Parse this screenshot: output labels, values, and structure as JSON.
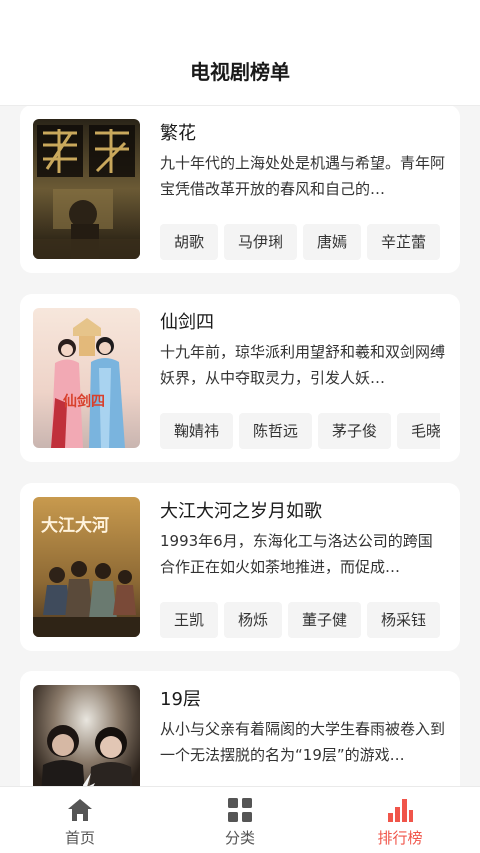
{
  "header": {
    "title": "电视剧榜单"
  },
  "dramas": [
    {
      "title": "繁花",
      "description": "九十年代的上海处处是机遇与希望。青年阿宝凭借改革开放的春风和自己的…",
      "cast": [
        "胡歌",
        "马伊琍",
        "唐嫣",
        "辛芷蕾"
      ],
      "poster_icon": "poster-fanhua"
    },
    {
      "title": "仙剑四",
      "description": "十九年前，琼华派利用望舒和羲和双剑网缚妖界，从中夺取灵力，引发人妖…",
      "cast": [
        "鞠婧祎",
        "陈哲远",
        "茅子俊",
        "毛晓"
      ],
      "poster_icon": "poster-xianjian"
    },
    {
      "title": "大江大河之岁月如歌",
      "description": "1993年6月，东海化工与洛达公司的跨国合作正在如火如荼地推进，而促成…",
      "cast": [
        "王凯",
        "杨烁",
        "董子健",
        "杨采钰"
      ],
      "poster_icon": "poster-dajiang"
    },
    {
      "title": "19层",
      "description": "从小与父亲有着隔阂的大学生春雨被卷入到一个无法摆脱的名为“19层”的游戏…",
      "cast": [],
      "poster_icon": "poster-19ceng"
    }
  ],
  "tabbar": {
    "items": [
      {
        "label": "首页",
        "icon": "home-icon"
      },
      {
        "label": "分类",
        "icon": "grid-icon"
      },
      {
        "label": "排行榜",
        "icon": "bar-chart-icon"
      }
    ],
    "active_index": 2,
    "active_color": "#f0554a",
    "inactive_color": "#555555"
  }
}
